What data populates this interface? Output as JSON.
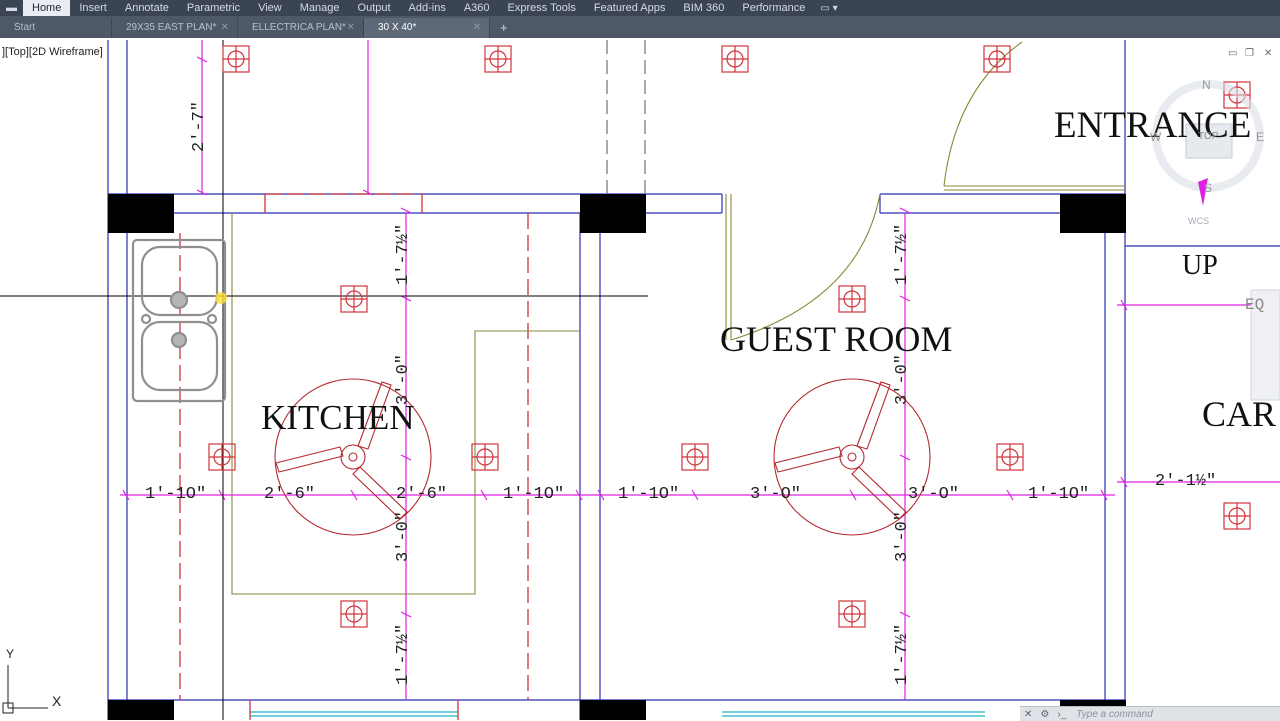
{
  "ribbon": {
    "tabs": [
      "Home",
      "Insert",
      "Annotate",
      "Parametric",
      "View",
      "Manage",
      "Output",
      "Add-ins",
      "A360",
      "Express Tools",
      "Featured Apps",
      "BIM 360",
      "Performance"
    ]
  },
  "file_tabs": {
    "items": [
      "Start",
      "29X35 EAST PLAN*",
      "ELLECTRICA PLAN*",
      "30 X 40*"
    ],
    "active_index": 3
  },
  "viewport": {
    "label": "][Top][2D Wireframe]"
  },
  "rooms": {
    "kitchen": "KITCHEN",
    "guest_room": "GUEST ROOM",
    "entrance": "ENTRANCE",
    "up": "UP",
    "car": "CAR"
  },
  "dims": {
    "top_left_v": "2'-7\"",
    "kitchen_top_v": "1'-7½\"",
    "kitchen_mid_v": "3'-0\"",
    "kitchen_low_v": "3'-0\"",
    "kitchen_bottom_v": "1'-7½\"",
    "h1": "1'-1O\"",
    "h2": "2'-6\"",
    "h3": "2'-6\"",
    "h4": "1'-1O\"",
    "h5": "1'-1O\"",
    "h6": "3'-O\"",
    "h7": "3'-O\"",
    "h8": "1'-1O\"",
    "guest_top_v": "1'-7½\"",
    "guest_mid_v": "3'-0\"",
    "guest_low_v": "3'-0\"",
    "guest_bottom_v": "1'-7½\"",
    "right_h": "2'-1½\"",
    "eq": "EQ"
  },
  "compass": {
    "n": "N",
    "w": "W",
    "e": "E",
    "s": "S",
    "top": "TOP",
    "wcs": "WCS"
  },
  "ucs": {
    "x": "X",
    "y": "Y"
  },
  "command_line": {
    "placeholder": "Type a command"
  },
  "colors": {
    "ribbon_bg": "#3b4453",
    "wall_blue": "#2a2fb8",
    "column_black": "#000000",
    "magenta_dim": "#e020e0",
    "red_fixture": "#b5282f",
    "olive_line": "#8a8a3a"
  }
}
